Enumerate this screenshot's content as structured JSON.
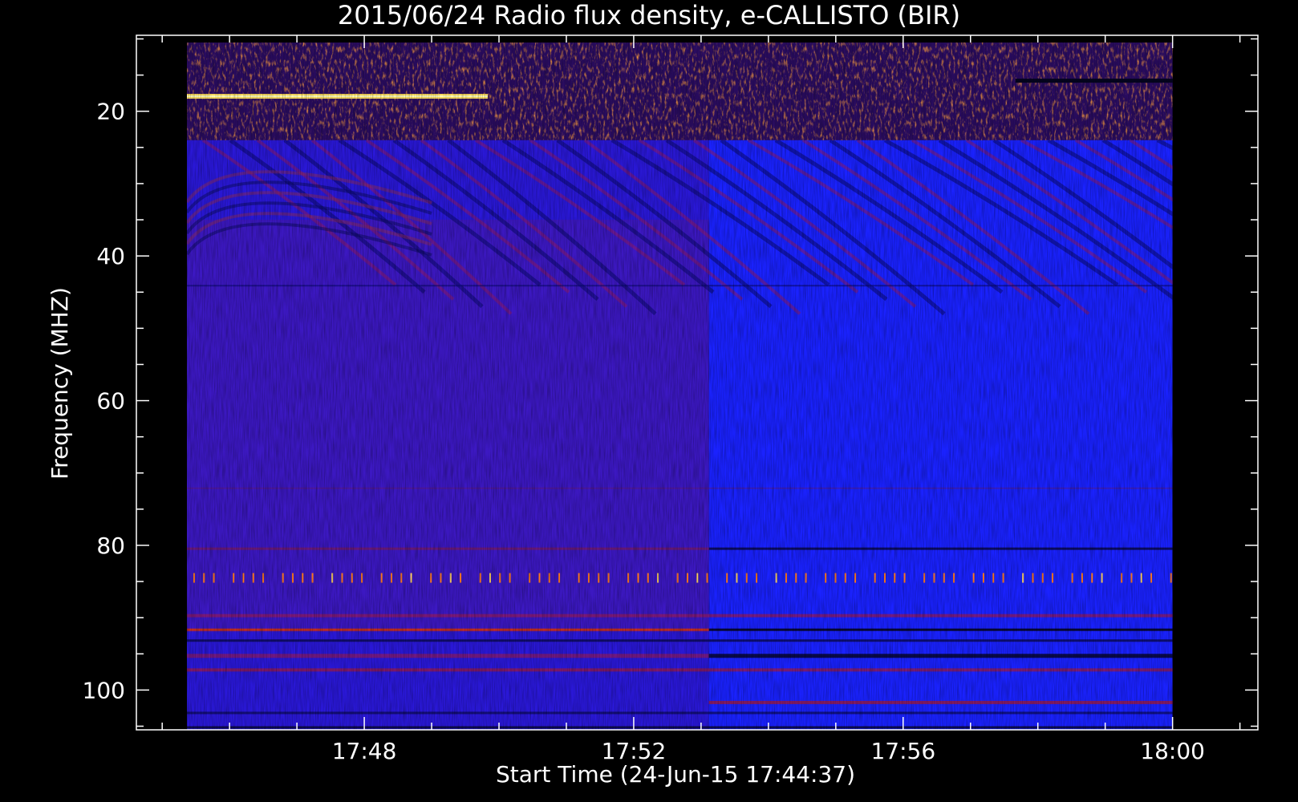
{
  "chart_data": {
    "type": "heatmap",
    "title": "2015/06/24  Radio flux density, e-CALLISTO (BIR)",
    "xlabel": "Start Time (24-Jun-15 17:44:37)",
    "ylabel": "Frequency (MHZ)",
    "x_tick_labels": [
      "17:48",
      "17:52",
      "17:56",
      "18:00"
    ],
    "y_tick_labels": [
      "20",
      "40",
      "60",
      "80",
      "100"
    ],
    "y_ticks": [
      20,
      40,
      60,
      80,
      100
    ],
    "y_axis_inverted": true,
    "xlim": [
      "17:44:37",
      "18:01:16"
    ],
    "ylim": [
      105.5,
      9.5
    ],
    "data_extent": {
      "x": [
        "17:45:22",
        "18:00:00"
      ],
      "y": [
        10.5,
        105.5
      ]
    },
    "regime_change_time": "17:53:07",
    "colormap": [
      "#000000",
      "#0a0a6e",
      "#1a1aff",
      "#8a1a7a",
      "#d02010",
      "#ff8a00",
      "#ffff80"
    ],
    "features": [
      {
        "type": "band",
        "freq_range": [
          10.5,
          24
        ],
        "description": "RFI"
      },
      {
        "type": "line",
        "freq": 18,
        "end_time": "17:49:50"
      },
      {
        "type": "line",
        "freq": 84.5
      },
      {
        "type": "line",
        "freq": 91.5
      }
    ],
    "grid": false,
    "legend": "none"
  }
}
